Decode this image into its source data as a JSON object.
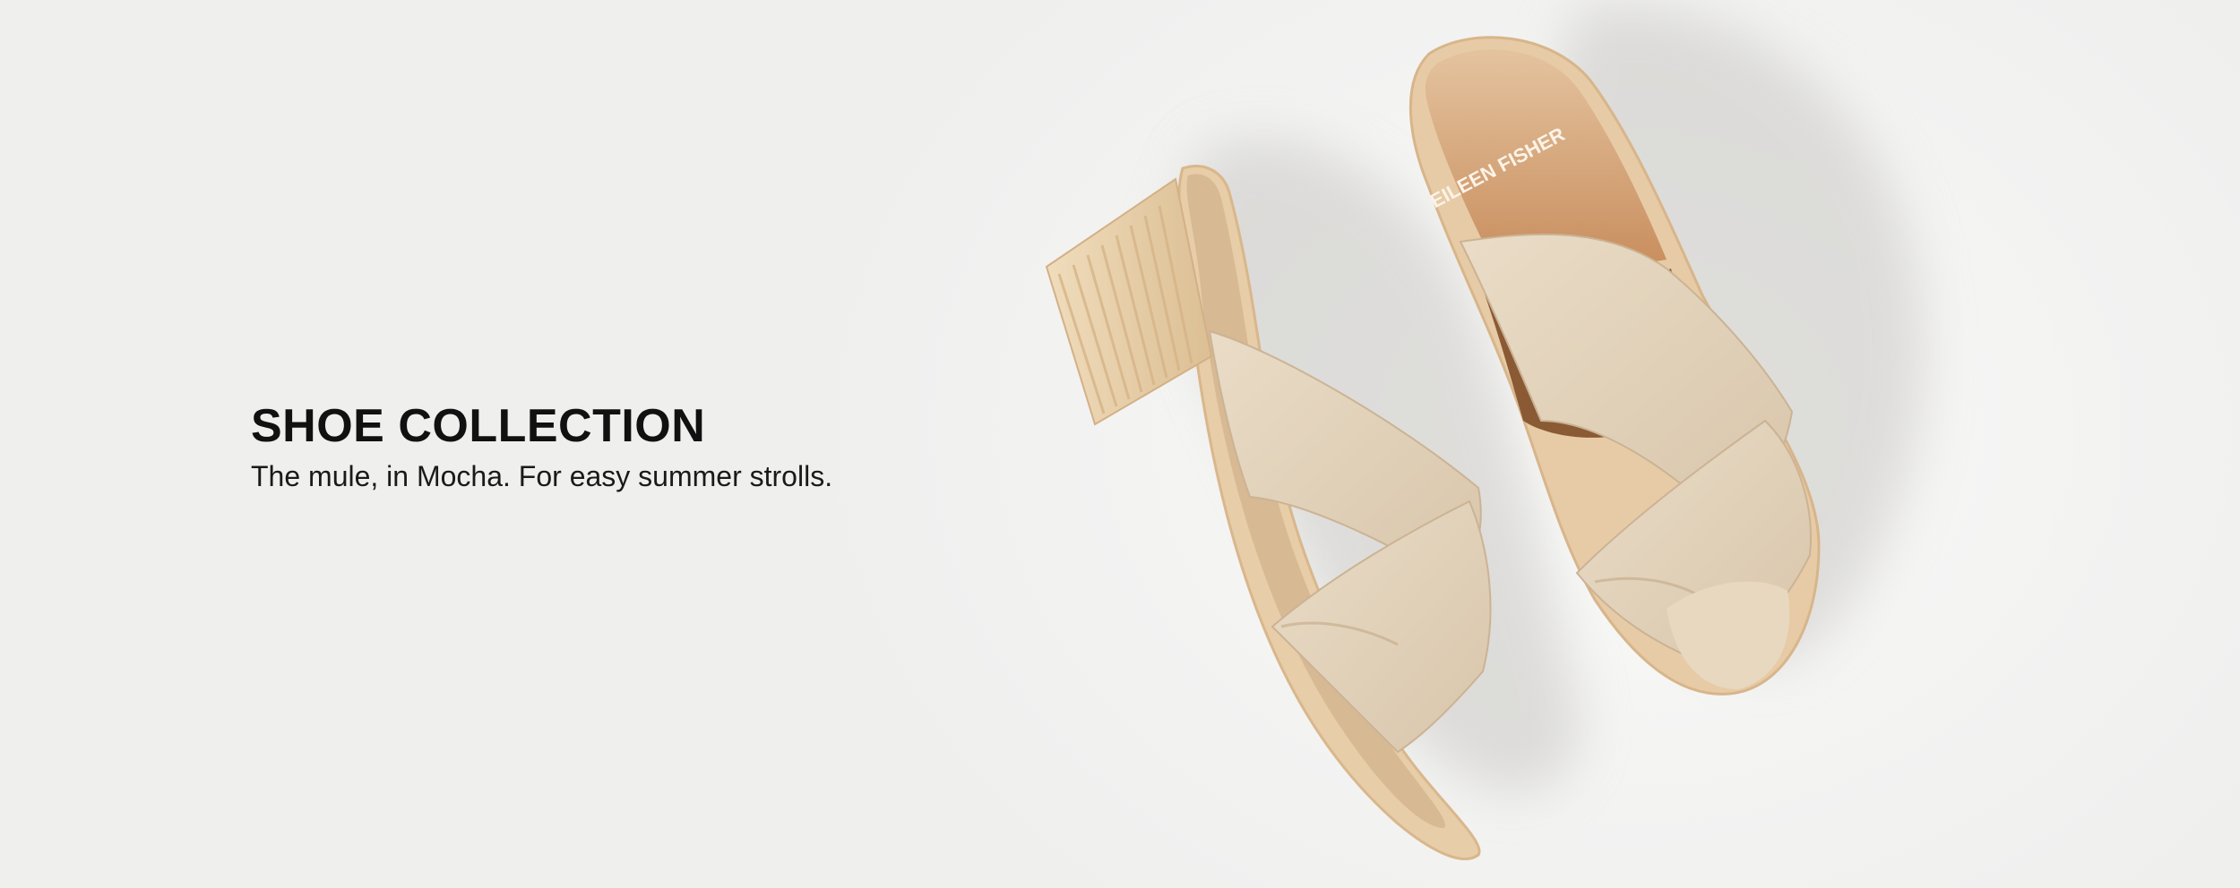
{
  "hero": {
    "headline": "SHOE COLLECTION",
    "subline": "The mule, in Mocha. For easy summer strolls.",
    "brand_stamp": "EILEEN FISHER",
    "colors": {
      "background": "#f4f4f3",
      "headline": "#111111",
      "shoe_upper": "#e2d3bd",
      "shoe_insole": "#d9b58f",
      "heel_wood": "#e8cfa8"
    }
  }
}
